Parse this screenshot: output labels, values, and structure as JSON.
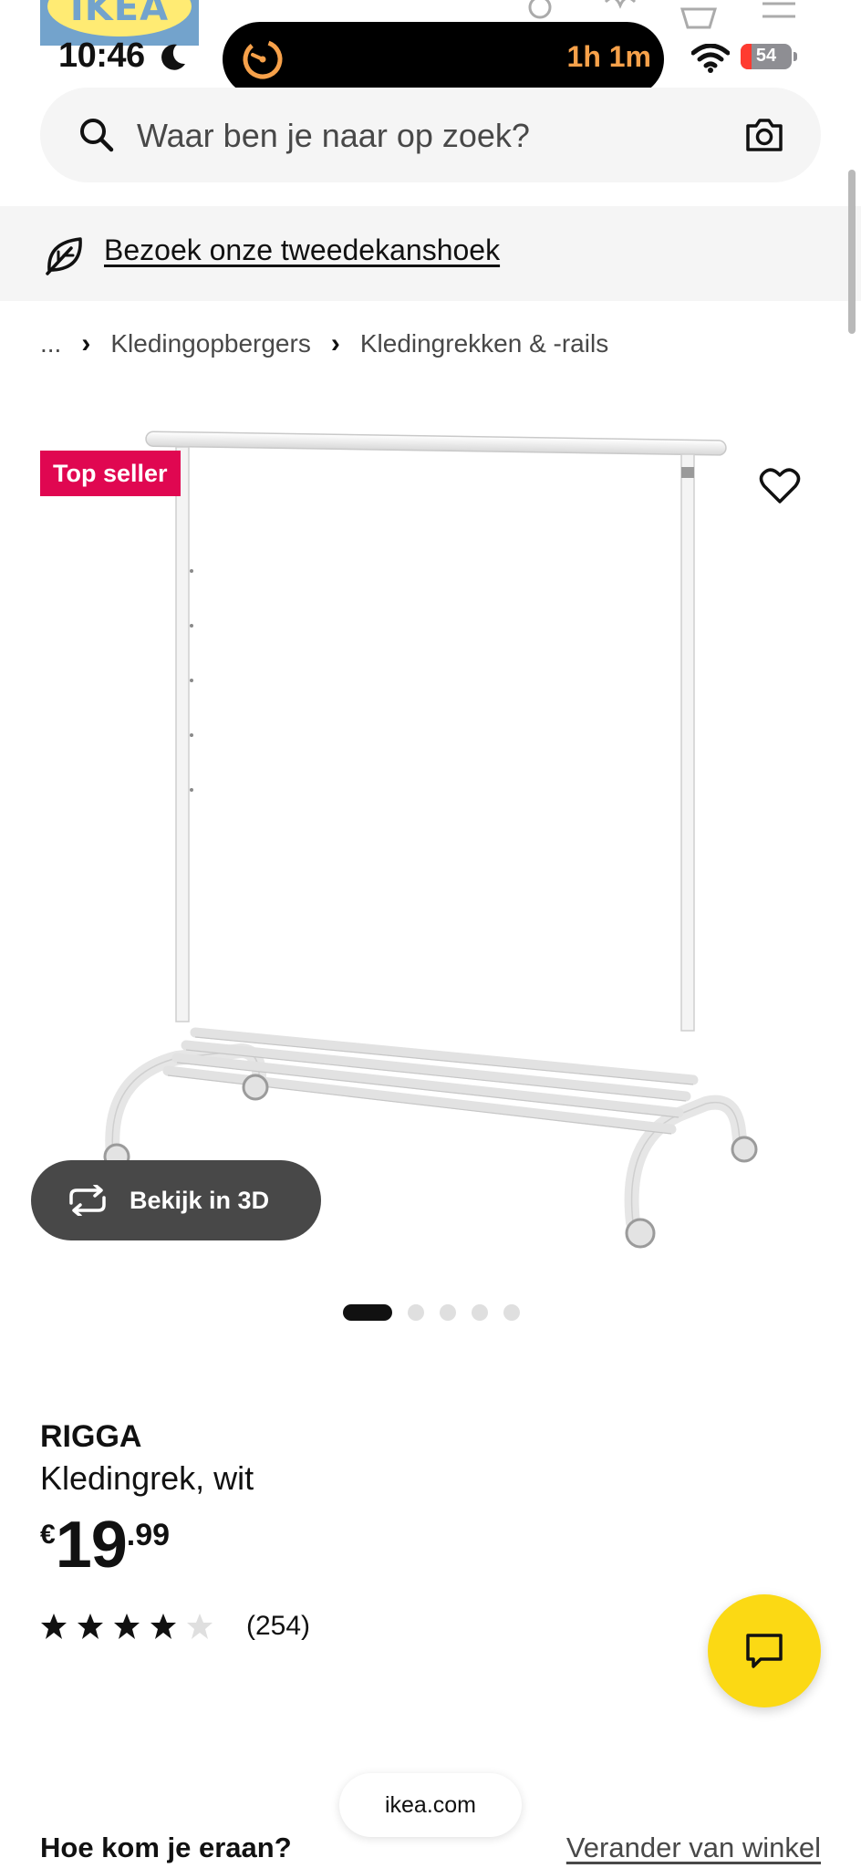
{
  "status_bar": {
    "time": "10:46",
    "activity_timer": "1h 1m",
    "battery_percent": "54"
  },
  "header": {
    "logo_text": "IKEA"
  },
  "search": {
    "placeholder": "Waar ben je naar op zoek?"
  },
  "banner": {
    "link_text": "Bezoek onze tweedekanshoek"
  },
  "breadcrumb": {
    "items": [
      "...",
      "Kledingopbergers",
      "Kledingrekken & -rails"
    ]
  },
  "product": {
    "badge": "Top seller",
    "view_3d_label": "Bekijk in 3D",
    "image_count": 5,
    "active_image_index": 0,
    "name": "RIGGA",
    "description": "Kledingrek, wit",
    "price_currency": "€",
    "price_whole": "19",
    "price_cents": ".99",
    "rating_value": 4,
    "rating_max": 5,
    "review_count": "(254)"
  },
  "browser": {
    "url": "ikea.com"
  },
  "delivery": {
    "title": "Hoe kom je eraan?",
    "change_store": "Verander van winkel"
  },
  "colors": {
    "badge_red": "#e00751",
    "chat_yellow": "#fbd914",
    "timer_orange": "#f7a14a"
  }
}
